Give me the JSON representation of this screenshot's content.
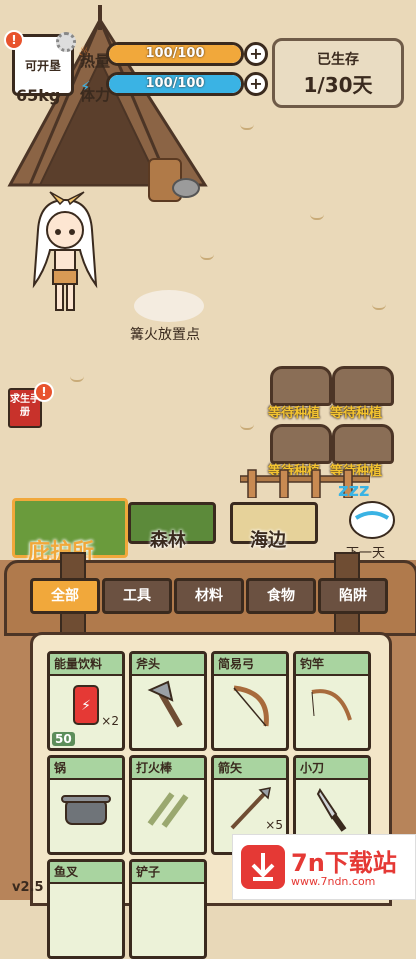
{
  "hud": {
    "avatar_label": "可开垦",
    "alert": "!",
    "weight": "65kg",
    "stats": [
      {
        "label": "热量",
        "value": "100/100",
        "fraction": 1.0,
        "color": "#f1a83b"
      },
      {
        "label": "体力",
        "value": "100/100",
        "fraction": 1.0,
        "color": "#3ab3e4"
      }
    ],
    "survived": {
      "title": "已生存",
      "days": "1/30天"
    }
  },
  "scene": {
    "campfire_label": "篝火放置点",
    "manual_label": "求生手册",
    "plots": [
      "等待种植",
      "等待种植",
      "等待种植",
      "等待种植"
    ],
    "locations": [
      {
        "label": "庇护所",
        "active": true
      },
      {
        "label": "森林",
        "active": false
      },
      {
        "label": "海边",
        "active": false
      }
    ],
    "next_day_label": "下一天",
    "sleep_icon": "zzz"
  },
  "inventory": {
    "tabs": [
      "全部",
      "工具",
      "材料",
      "食物",
      "陷阱"
    ],
    "active_tab": 0,
    "items": [
      {
        "name": "能量饮料",
        "qty": "×2",
        "badge": "50",
        "icon": "can-icon"
      },
      {
        "name": "斧头",
        "qty": "",
        "badge": "",
        "icon": "axe-icon"
      },
      {
        "name": "简易弓",
        "qty": "",
        "badge": "",
        "icon": "bow-icon"
      },
      {
        "name": "钓竿",
        "qty": "",
        "badge": "",
        "icon": "fishing-rod-icon"
      },
      {
        "name": "锅",
        "qty": "",
        "badge": "",
        "icon": "pot-icon"
      },
      {
        "name": "打火棒",
        "qty": "",
        "badge": "",
        "icon": "fire-starter-icon"
      },
      {
        "name": "箭矢",
        "qty": "×5",
        "badge": "",
        "icon": "arrow-icon"
      },
      {
        "name": "小刀",
        "qty": "",
        "badge": "",
        "icon": "knife-icon"
      },
      {
        "name": "鱼叉",
        "qty": "",
        "badge": "",
        "icon": "harpoon-icon"
      },
      {
        "name": "铲子",
        "qty": "",
        "badge": "",
        "icon": "shovel-icon"
      }
    ]
  },
  "version": "v2.5",
  "watermark": {
    "title": "7n下载站",
    "url": "www.7ndn.com"
  }
}
